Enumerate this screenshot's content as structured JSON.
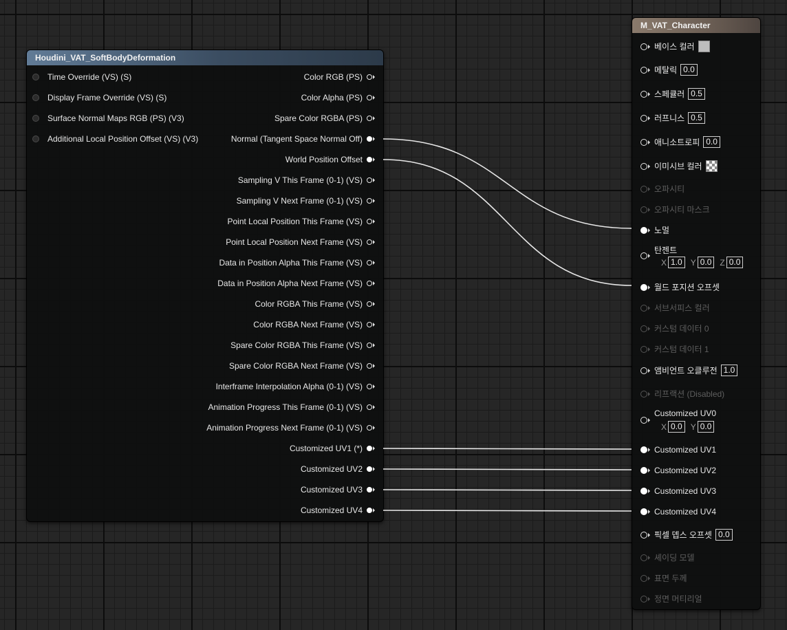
{
  "left_node": {
    "title": "Houdini_VAT_SoftBodyDeformation",
    "inputs": [
      "Time Override (VS) (S)",
      "Display Frame Override (VS) (S)",
      "Surface Normal Maps RGB (PS) (V3)",
      "Additional Local Position Offset (VS) (V3)"
    ],
    "outputs": [
      "Color RGB (PS)",
      "Color Alpha (PS)",
      "Spare Color RGBA (PS)",
      "Normal (Tangent Space Normal Off)",
      "World Position Offset",
      "Sampling V This Frame (0-1) (VS)",
      "Sampling V Next Frame (0-1) (VS)",
      "Point Local Position This Frame (VS)",
      "Point Local Position Next Frame (VS)",
      "Data in Position Alpha This Frame (VS)",
      "Data in Position Alpha Next Frame (VS)",
      "Color RGBA This Frame (VS)",
      "Color RGBA Next Frame (VS)",
      "Spare Color RGBA This Frame (VS)",
      "Spare Color RGBA Next Frame (VS)",
      "Interframe Interpolation Alpha (0-1) (VS)",
      "Animation Progress This Frame (0-1) (VS)",
      "Animation Progress Next Frame (0-1) (VS)",
      "Customized UV1 (*)",
      "Customized UV2",
      "Customized UV3",
      "Customized UV4"
    ]
  },
  "right_node": {
    "title": "M_VAT_Character",
    "pins": {
      "base_color": "베이스 컬러",
      "metallic": "메탈릭",
      "metallic_value": "0.0",
      "specular": "스페큘러",
      "specular_value": "0.5",
      "roughness": "러프니스",
      "roughness_value": "0.5",
      "anisotropy": "애니소트로피",
      "anisotropy_value": "0.0",
      "emissive_color": "이미시브 컬러",
      "opacity": "오파시티",
      "opacity_mask": "오파시티 마스크",
      "normal": "노멀",
      "tangent": "탄젠트",
      "tangent_x": "1.0",
      "tangent_y": "0.0",
      "tangent_z": "0.0",
      "world_position_offset": "월드 포지션 오프셋",
      "subsurface_color": "서브서피스 컬러",
      "custom_data_0": "커스텀 데이터 0",
      "custom_data_1": "커스텀 데이터 1",
      "ambient_occlusion": "앰비언트 오클루전",
      "ambient_occlusion_value": "1.0",
      "refraction": "리프랙션 (Disabled)",
      "customized_uv0": "Customized UV0",
      "uv0_x": "0.0",
      "uv0_y": "0.0",
      "customized_uv1": "Customized UV1",
      "customized_uv2": "Customized UV2",
      "customized_uv3": "Customized UV3",
      "customized_uv4": "Customized UV4",
      "pixel_depth_offset": "픽셀 뎁스 오프셋",
      "pixel_depth_offset_value": "0.0",
      "shading_model": "셰이딩 모델",
      "surface_thickness": "표면 두께",
      "front_material": "정면 머티리얼"
    },
    "axis_labels": {
      "x": "X",
      "y": "Y",
      "z": "Z"
    }
  },
  "colors": {
    "canvas": "#262626",
    "node_body": "#0e0f0f",
    "function_header": "#617b96",
    "material_header": "#8a7a6c",
    "wire": "#e8e8e8"
  }
}
